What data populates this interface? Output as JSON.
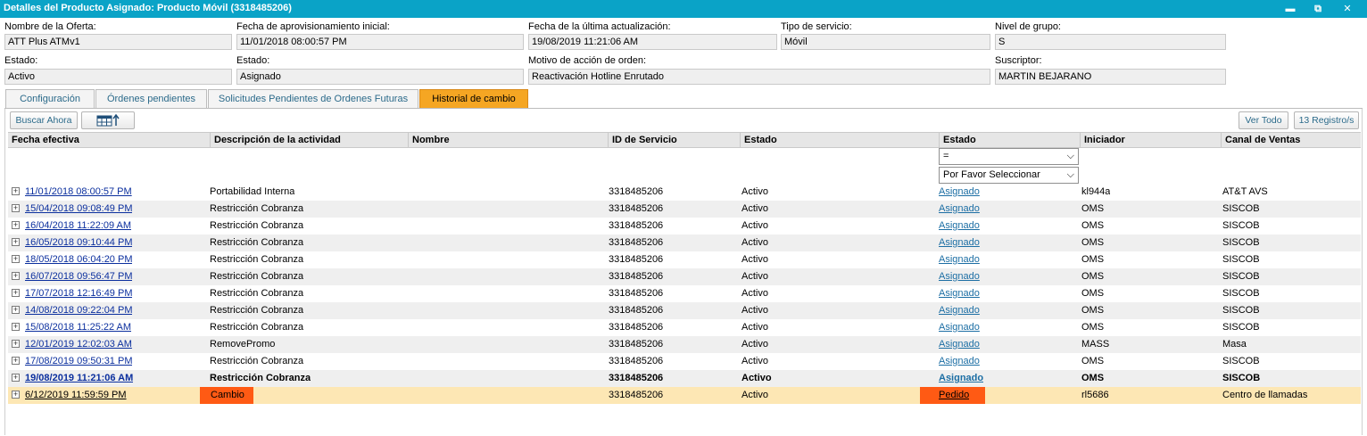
{
  "window": {
    "title": "Detalles del Producto Asignado: Producto Móvil (3318485206)",
    "minimize": "▬",
    "restore": "⧉",
    "close": "✕"
  },
  "fields": {
    "oferta": {
      "label": "Nombre de la Oferta:",
      "value": "ATT Plus ATMv1"
    },
    "fecha_aprov": {
      "label": "Fecha de aprovisionamiento inicial:",
      "value": "11/01/2018 08:00:57 PM"
    },
    "fecha_act": {
      "label": "Fecha de la última actualización:",
      "value": "19/08/2019 11:21:06 AM"
    },
    "tipo_servicio": {
      "label": "Tipo de servicio:",
      "value": "Móvil"
    },
    "nivel_grupo": {
      "label": "Nivel de grupo:",
      "value": "S"
    },
    "estado1": {
      "label": "Estado:",
      "value": "Activo"
    },
    "estado2": {
      "label": "Estado:",
      "value": "Asignado"
    },
    "motivo": {
      "label": "Motivo de acción de orden:",
      "value": "Reactivación Hotline Enrutado"
    },
    "suscriptor": {
      "label": "Suscriptor:",
      "value": "MARTIN BEJARANO"
    }
  },
  "tabs": [
    "Configuración",
    "Órdenes pendientes",
    "Solicitudes Pendientes de Ordenes Futuras",
    "Historial de cambio"
  ],
  "toolbar": {
    "buscar": "Buscar Ahora",
    "ver_todo": "Ver Todo",
    "registros": "13 Registro/s"
  },
  "columns": [
    "Fecha efectiva",
    "Descripción de la actividad",
    "Nombre",
    "ID de Servicio",
    "Estado",
    "Estado",
    "Iniciador",
    "Canal de Ventas"
  ],
  "filter": {
    "operator": "=",
    "select": "Por Favor Seleccionar"
  },
  "rows": [
    {
      "fecha": "11/01/2018 08:00:57 PM",
      "desc": "Portabilidad Interna",
      "nombre": "",
      "id": "3318485206",
      "estado": "Activo",
      "estado2": "Asignado",
      "iniciador": "kl944a",
      "canal": "AT&T AVS"
    },
    {
      "fecha": "15/04/2018 09:08:49 PM",
      "desc": "Restricción Cobranza",
      "nombre": "",
      "id": "3318485206",
      "estado": "Activo",
      "estado2": "Asignado",
      "iniciador": "OMS",
      "canal": "SISCOB"
    },
    {
      "fecha": "16/04/2018 11:22:09 AM",
      "desc": "Restricción Cobranza",
      "nombre": "",
      "id": "3318485206",
      "estado": "Activo",
      "estado2": "Asignado",
      "iniciador": "OMS",
      "canal": "SISCOB"
    },
    {
      "fecha": "16/05/2018 09:10:44 PM",
      "desc": "Restricción Cobranza",
      "nombre": "",
      "id": "3318485206",
      "estado": "Activo",
      "estado2": "Asignado",
      "iniciador": "OMS",
      "canal": "SISCOB"
    },
    {
      "fecha": "18/05/2018 06:04:20 PM",
      "desc": "Restricción Cobranza",
      "nombre": "",
      "id": "3318485206",
      "estado": "Activo",
      "estado2": "Asignado",
      "iniciador": "OMS",
      "canal": "SISCOB"
    },
    {
      "fecha": "16/07/2018 09:56:47 PM",
      "desc": "Restricción Cobranza",
      "nombre": "",
      "id": "3318485206",
      "estado": "Activo",
      "estado2": "Asignado",
      "iniciador": "OMS",
      "canal": "SISCOB"
    },
    {
      "fecha": "17/07/2018 12:16:49 PM",
      "desc": "Restricción Cobranza",
      "nombre": "",
      "id": "3318485206",
      "estado": "Activo",
      "estado2": "Asignado",
      "iniciador": "OMS",
      "canal": "SISCOB"
    },
    {
      "fecha": "14/08/2018 09:22:04 PM",
      "desc": "Restricción Cobranza",
      "nombre": "",
      "id": "3318485206",
      "estado": "Activo",
      "estado2": "Asignado",
      "iniciador": "OMS",
      "canal": "SISCOB"
    },
    {
      "fecha": "15/08/2018 11:25:22 AM",
      "desc": "Restricción Cobranza",
      "nombre": "",
      "id": "3318485206",
      "estado": "Activo",
      "estado2": "Asignado",
      "iniciador": "OMS",
      "canal": "SISCOB"
    },
    {
      "fecha": "12/01/2019 12:02:03 AM",
      "desc": "RemovePromo",
      "nombre": "",
      "id": "3318485206",
      "estado": "Activo",
      "estado2": "Asignado",
      "iniciador": "MASS",
      "canal": "Masa"
    },
    {
      "fecha": "17/08/2019 09:50:31 PM",
      "desc": "Restricción Cobranza",
      "nombre": "",
      "id": "3318485206",
      "estado": "Activo",
      "estado2": "Asignado",
      "iniciador": "OMS",
      "canal": "SISCOB"
    },
    {
      "fecha": "19/08/2019 11:21:06 AM",
      "desc": "Restricción Cobranza",
      "nombre": "",
      "id": "3318485206",
      "estado": "Activo",
      "estado2": "Asignado",
      "iniciador": "OMS",
      "canal": "SISCOB",
      "bold": true
    },
    {
      "fecha": "6/12/2019 11:59:59 PM",
      "desc": "Cambio",
      "nombre": "",
      "id": "3318485206",
      "estado": "Activo",
      "estado2": "Pedido",
      "iniciador": "rl5686",
      "canal": "Centro de llamadas",
      "highlight": true
    }
  ],
  "colors": {
    "titlebar": "#0aa3c7",
    "active_tab": "#f5a623",
    "highlight_row": "#fde7b4",
    "marker": "#ff5a14"
  }
}
